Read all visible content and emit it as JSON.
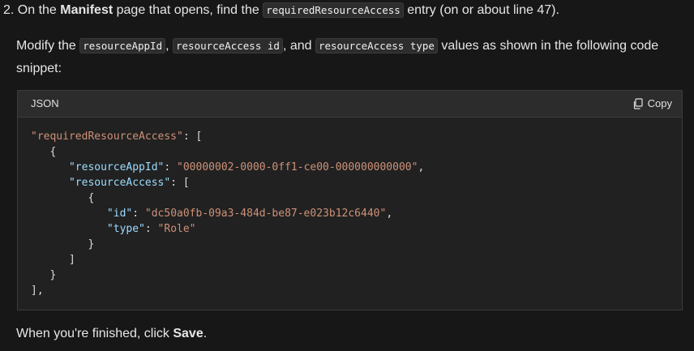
{
  "step": {
    "prefix": "2. On the ",
    "bold": "Manifest",
    "middle": " page that opens, find the ",
    "code": "requiredResourceAccess",
    "suffix": " entry (on or about line 47)."
  },
  "instruction": {
    "prefix": "Modify the ",
    "code1": "resourceAppId",
    "sep1": ", ",
    "code2": "resourceAccess id",
    "sep2": ", and ",
    "code3": "resourceAccess type",
    "suffix": " values as shown in the following code snippet:"
  },
  "code_block": {
    "language": "JSON",
    "copy_label": "Copy",
    "root_key": "\"requiredResourceAccess\"",
    "app_id_key": "\"resourceAppId\"",
    "app_id_value": "\"00000002-0000-0ff1-ce00-000000000000\"",
    "access_key": "\"resourceAccess\"",
    "id_key": "\"id\"",
    "id_value": "\"dc50a0fb-09a3-484d-be87-e023b12c6440\"",
    "type_key": "\"type\"",
    "type_value": "\"Role\""
  },
  "finish": {
    "prefix": "When you're finished, click ",
    "bold": "Save",
    "suffix": "."
  }
}
